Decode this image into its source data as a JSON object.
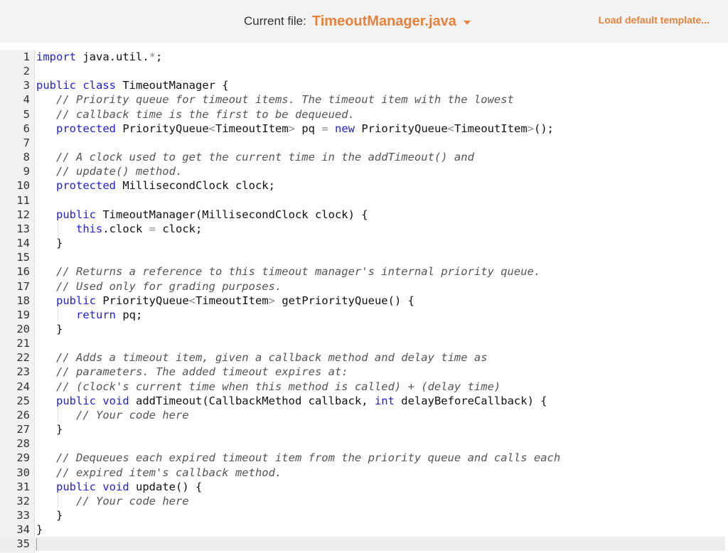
{
  "header": {
    "current_file_label": "Current file:",
    "current_file_name": "TimeoutManager.java",
    "dropdown_icon": "caret-down-icon",
    "load_template_label": "Load default template..."
  },
  "editor": {
    "active_line": 35,
    "lines": [
      {
        "n": "1",
        "indent": 0,
        "tokens": [
          {
            "t": "kw",
            "v": "import"
          },
          {
            "t": "tx",
            "v": " java.util."
          },
          {
            "t": "op",
            "v": "*"
          },
          {
            "t": "tx",
            "v": ";"
          }
        ]
      },
      {
        "n": "2",
        "indent": 0,
        "tokens": []
      },
      {
        "n": "3",
        "indent": 0,
        "tokens": [
          {
            "t": "kw",
            "v": "public"
          },
          {
            "t": "tx",
            "v": " "
          },
          {
            "t": "kw",
            "v": "class"
          },
          {
            "t": "tx",
            "v": " TimeoutManager {"
          }
        ]
      },
      {
        "n": "4",
        "indent": 1,
        "tokens": [
          {
            "t": "cm",
            "v": "// Priority queue for timeout items. The timeout item with the lowest"
          }
        ]
      },
      {
        "n": "5",
        "indent": 1,
        "tokens": [
          {
            "t": "cm",
            "v": "// callback time is the first to be dequeued."
          }
        ]
      },
      {
        "n": "6",
        "indent": 1,
        "tokens": [
          {
            "t": "kw",
            "v": "protected"
          },
          {
            "t": "tx",
            "v": " PriorityQueue"
          },
          {
            "t": "op",
            "v": "<"
          },
          {
            "t": "tx",
            "v": "TimeoutItem"
          },
          {
            "t": "op",
            "v": ">"
          },
          {
            "t": "tx",
            "v": " pq "
          },
          {
            "t": "op",
            "v": "="
          },
          {
            "t": "tx",
            "v": " "
          },
          {
            "t": "kw",
            "v": "new"
          },
          {
            "t": "tx",
            "v": " PriorityQueue"
          },
          {
            "t": "op",
            "v": "<"
          },
          {
            "t": "tx",
            "v": "TimeoutItem"
          },
          {
            "t": "op",
            "v": ">"
          },
          {
            "t": "tx",
            "v": "();"
          }
        ]
      },
      {
        "n": "7",
        "indent": 0,
        "tokens": []
      },
      {
        "n": "8",
        "indent": 1,
        "tokens": [
          {
            "t": "cm",
            "v": "// A clock used to get the current time in the addTimeout() and"
          }
        ]
      },
      {
        "n": "9",
        "indent": 1,
        "tokens": [
          {
            "t": "cm",
            "v": "// update() method."
          }
        ]
      },
      {
        "n": "10",
        "indent": 1,
        "tokens": [
          {
            "t": "kw",
            "v": "protected"
          },
          {
            "t": "tx",
            "v": " MillisecondClock clock;"
          }
        ]
      },
      {
        "n": "11",
        "indent": 0,
        "tokens": []
      },
      {
        "n": "12",
        "indent": 1,
        "tokens": [
          {
            "t": "kw",
            "v": "public"
          },
          {
            "t": "tx",
            "v": " TimeoutManager(MillisecondClock clock) {"
          }
        ]
      },
      {
        "n": "13",
        "indent": 2,
        "tokens": [
          {
            "t": "kw",
            "v": "this"
          },
          {
            "t": "tx",
            "v": ".clock "
          },
          {
            "t": "op",
            "v": "="
          },
          {
            "t": "tx",
            "v": " clock;"
          }
        ]
      },
      {
        "n": "14",
        "indent": 1,
        "tokens": [
          {
            "t": "tx",
            "v": "}"
          }
        ]
      },
      {
        "n": "15",
        "indent": 0,
        "tokens": []
      },
      {
        "n": "16",
        "indent": 1,
        "tokens": [
          {
            "t": "cm",
            "v": "// Returns a reference to this timeout manager's internal priority queue."
          }
        ]
      },
      {
        "n": "17",
        "indent": 1,
        "tokens": [
          {
            "t": "cm",
            "v": "// Used only for grading purposes."
          }
        ]
      },
      {
        "n": "18",
        "indent": 1,
        "tokens": [
          {
            "t": "kw",
            "v": "public"
          },
          {
            "t": "tx",
            "v": " PriorityQueue"
          },
          {
            "t": "op",
            "v": "<"
          },
          {
            "t": "tx",
            "v": "TimeoutItem"
          },
          {
            "t": "op",
            "v": ">"
          },
          {
            "t": "tx",
            "v": " getPriorityQueue() {"
          }
        ]
      },
      {
        "n": "19",
        "indent": 2,
        "tokens": [
          {
            "t": "kw",
            "v": "return"
          },
          {
            "t": "tx",
            "v": " pq;"
          }
        ]
      },
      {
        "n": "20",
        "indent": 1,
        "tokens": [
          {
            "t": "tx",
            "v": "}"
          }
        ]
      },
      {
        "n": "21",
        "indent": 0,
        "tokens": []
      },
      {
        "n": "22",
        "indent": 1,
        "tokens": [
          {
            "t": "cm",
            "v": "// Adds a timeout item, given a callback method and delay time as"
          }
        ]
      },
      {
        "n": "23",
        "indent": 1,
        "tokens": [
          {
            "t": "cm",
            "v": "// parameters. The added timeout expires at:"
          }
        ]
      },
      {
        "n": "24",
        "indent": 1,
        "tokens": [
          {
            "t": "cm",
            "v": "// (clock's current time when this method is called) + (delay time)"
          }
        ]
      },
      {
        "n": "25",
        "indent": 1,
        "tokens": [
          {
            "t": "kw",
            "v": "public"
          },
          {
            "t": "tx",
            "v": " "
          },
          {
            "t": "kw",
            "v": "void"
          },
          {
            "t": "tx",
            "v": " addTimeout(CallbackMethod callback, "
          },
          {
            "t": "kw",
            "v": "int"
          },
          {
            "t": "tx",
            "v": " delayBeforeCallback) {"
          }
        ]
      },
      {
        "n": "26",
        "indent": 2,
        "tokens": [
          {
            "t": "cm",
            "v": "// Your code here"
          }
        ]
      },
      {
        "n": "27",
        "indent": 1,
        "tokens": [
          {
            "t": "tx",
            "v": "}"
          }
        ]
      },
      {
        "n": "28",
        "indent": 0,
        "tokens": []
      },
      {
        "n": "29",
        "indent": 1,
        "tokens": [
          {
            "t": "cm",
            "v": "// Dequeues each expired timeout item from the priority queue and calls each"
          }
        ]
      },
      {
        "n": "30",
        "indent": 1,
        "tokens": [
          {
            "t": "cm",
            "v": "// expired item's callback method."
          }
        ]
      },
      {
        "n": "31",
        "indent": 1,
        "tokens": [
          {
            "t": "kw",
            "v": "public"
          },
          {
            "t": "tx",
            "v": " "
          },
          {
            "t": "kw",
            "v": "void"
          },
          {
            "t": "tx",
            "v": " update() {"
          }
        ]
      },
      {
        "n": "32",
        "indent": 2,
        "tokens": [
          {
            "t": "cm",
            "v": "// Your code here"
          }
        ]
      },
      {
        "n": "33",
        "indent": 1,
        "tokens": [
          {
            "t": "tx",
            "v": "}"
          }
        ]
      },
      {
        "n": "34",
        "indent": 0,
        "tokens": [
          {
            "t": "tx",
            "v": "}"
          }
        ]
      },
      {
        "n": "35",
        "indent": 0,
        "tokens": []
      }
    ]
  },
  "colors": {
    "accent": "#e9813a",
    "keyword": "#1f1fd8",
    "comment": "#555555",
    "gutter_bg": "#f1f1f1"
  }
}
